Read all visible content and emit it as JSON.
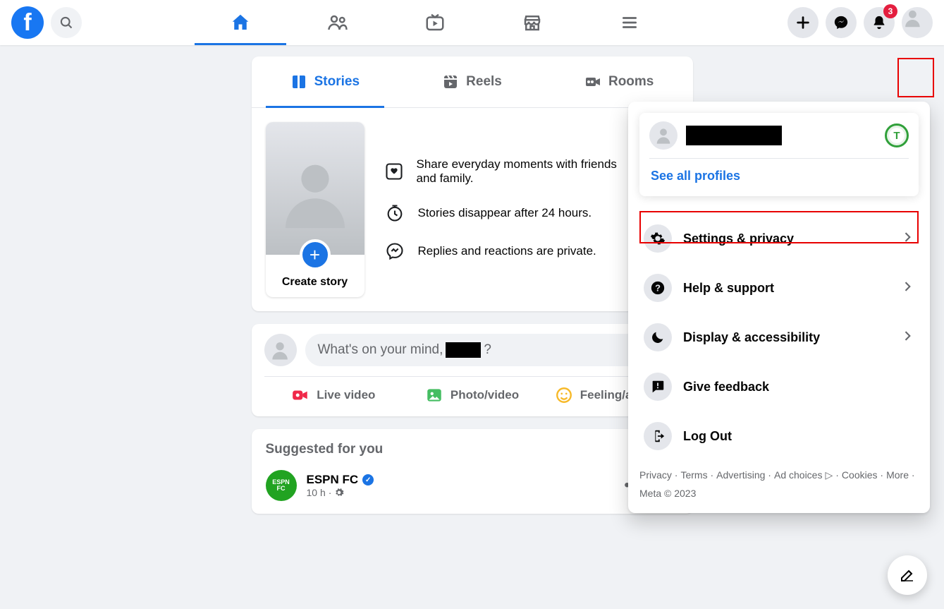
{
  "topbar": {
    "notifications_badge": "3"
  },
  "tabs": {
    "stories": "Stories",
    "reels": "Reels",
    "rooms": "Rooms"
  },
  "stories": {
    "create_label": "Create story",
    "line1": "Share everyday moments with friends and family.",
    "line2": "Stories disappear after 24 hours.",
    "line3": "Replies and reactions are private."
  },
  "composer": {
    "prompt_prefix": "What's on your mind, ",
    "prompt_suffix": "?",
    "live": "Live video",
    "photo": "Photo/video",
    "feeling": "Feeling/activity"
  },
  "suggested": {
    "heading": "Suggested for you",
    "item": {
      "name": "ESPN FC",
      "time": "10 h",
      "logo_text": "ESPN\nFC"
    }
  },
  "account_menu": {
    "see_all": "See all profiles",
    "items": {
      "settings": "Settings & privacy",
      "help": "Help & support",
      "display": "Display & accessibility",
      "feedback": "Give feedback",
      "logout": "Log Out"
    },
    "footer": {
      "privacy": "Privacy",
      "terms": "Terms",
      "advertising": "Advertising",
      "ad_choices": "Ad choices",
      "cookies": "Cookies",
      "more": "More",
      "copyright": "Meta © 2023"
    },
    "switch_letter": "T"
  }
}
